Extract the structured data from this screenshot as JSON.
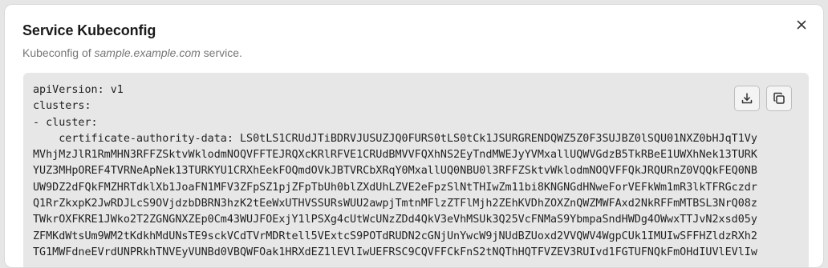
{
  "dialog": {
    "title": "Service Kubeconfig",
    "subtitle_prefix": "Kubeconfig of ",
    "subtitle_host": "sample.example.com",
    "subtitle_suffix": " service.",
    "close_icon": "close-icon"
  },
  "toolbar": {
    "download_icon": "download-icon",
    "copy_icon": "copy-icon"
  },
  "code": {
    "lines": [
      "apiVersion: v1",
      "clusters:",
      "- cluster:",
      "    certificate-authority-data: LS0tLS1CRUdJTiBDRVJUSUZJQ0FURS0tLS0tCk1JSURGRENDQWZ5Z0F3SUJBZ0lSQU01NXZ0bHJqT1Vy",
      "MVhjMzJlR1RmMHN3RFFZSktvWklodmNOQVFFTEJRQXcKRlRFVE1CRUdBMVVFQXhNS2EyTndMWEJyYVMxallUQWVGdzB5TkRBeE1UWXhNek13TURK",
      "YUZ3MHpOREF4TVRNeApNek13TURKYU1CRXhEekFOQmdOVkJBTVRCbXRqY0MxallUQ0NBU0l3RFFZSktvWklodmNOQVFFQkJRQURnZ0VQQkFEQ0NB",
      "UW9DZ2dFQkFMZHRTdklXb1JoaFN1MFV3ZFpSZ1pjZFpTbUh0blZXdUhLZVE2eFpzSlNtTHIwZm11bi8KNGNGdHNweForVEFkWm1mR3lkTFRGczdr",
      "Q1RrZkxpK2JwRDJLcS9OVjdzbDBRN3hzK2tEeWxUTHVSSURsWUU2awpjTmtnMFlzZTFlMjh2ZEhKVDhZOXZnQWZMWFAxd2NkRFFmMTBSL3NrQ08z",
      "TWkrOXFKRE1JWko2T2ZGNGNXZEp0Cm43WUJFOExjY1lPSXg4cUtWcUNzZDd4QkV3eVhMSUk3Q25VcFNMaS9YbmpaSndHWDg4OWwxTTJvN2xsd05y",
      "ZFMKdWtsUm9WM2tKdkhMdUNsTE9sckVCdTVrMDRtell5VExtcS9POTdRUDN2cGNjUnYwcW9jNUdBZUoxd2VVQWV4WgpCUk1IMUIwSFFHZldzRXh2",
      "TG1MWFdneEVrdUNPRkhTNVEyVUNBd0VBQWFOak1HRXdEZ1lEVlIwUEFRSC9CQVFFCkFnS2tNQThHQTFVZEV3RUIvd1FGTUFNQkFmOHdIUVlEVlIw"
    ]
  }
}
